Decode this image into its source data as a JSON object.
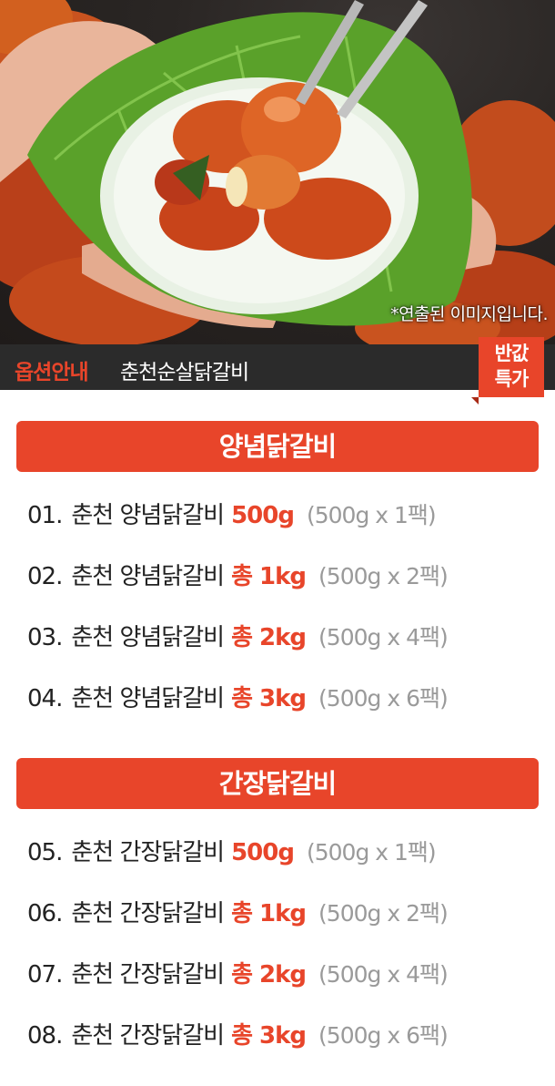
{
  "hero": {
    "caption": "*연출된 이미지입니다."
  },
  "option_bar": {
    "label": "옵션안내",
    "title": "춘천순살닭갈비"
  },
  "badge": {
    "line1": "반값",
    "line2": "특가"
  },
  "sections": [
    {
      "title": "양념닭갈비",
      "items": [
        {
          "num": "01.",
          "name": "춘천 양념닭갈비",
          "qty": "500g",
          "pack": "(500g x 1팩)"
        },
        {
          "num": "02.",
          "name": "춘천 양념닭갈비",
          "qty": "총 1kg",
          "pack": "(500g x 2팩)"
        },
        {
          "num": "03.",
          "name": "춘천 양념닭갈비",
          "qty": "총 2kg",
          "pack": "(500g x 4팩)"
        },
        {
          "num": "04.",
          "name": "춘천 양념닭갈비",
          "qty": "총 3kg",
          "pack": "(500g x 6팩)"
        }
      ]
    },
    {
      "title": "간장닭갈비",
      "items": [
        {
          "num": "05.",
          "name": "춘천 간장닭갈비",
          "qty": "500g",
          "pack": "(500g x 1팩)"
        },
        {
          "num": "06.",
          "name": "춘천 간장닭갈비",
          "qty": "총 1kg",
          "pack": "(500g x 2팩)"
        },
        {
          "num": "07.",
          "name": "춘천 간장닭갈비",
          "qty": "총 2kg",
          "pack": "(500g x 4팩)"
        },
        {
          "num": "08.",
          "name": "춘천 간장닭갈비",
          "qty": "총 3kg",
          "pack": "(500g x 6팩)"
        }
      ]
    }
  ],
  "colors": {
    "accent": "#e8452a",
    "bar": "#2b2b2b",
    "pack_text": "#9a9a9a"
  }
}
